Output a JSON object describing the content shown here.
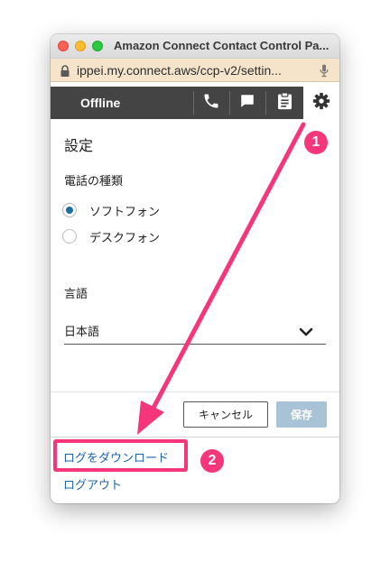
{
  "window": {
    "title": "Amazon Connect Contact Control Pa...",
    "url": "ippei.my.connect.aws/ccp-v2/settin..."
  },
  "header": {
    "status": "Offline",
    "icons": [
      "phone-icon",
      "chat-icon",
      "clipboard-icon",
      "gear-icon"
    ]
  },
  "settings": {
    "title": "設定",
    "phone_type_label": "電話の種類",
    "phone_options": [
      {
        "label": "ソフトフォン",
        "selected": true
      },
      {
        "label": "デスクフォン",
        "selected": false
      }
    ],
    "language_label": "言語",
    "language_value": "日本語"
  },
  "actions": {
    "cancel_label": "キャンセル",
    "save_label": "保存"
  },
  "links": {
    "download_logs": "ログをダウンロード",
    "logout": "ログアウト"
  },
  "annotations": {
    "callout_1": "1",
    "callout_2": "2",
    "color": "#f5367a"
  },
  "colors": {
    "header_bg": "#444444",
    "radio_selected": "#1d6ea1",
    "save_disabled": "#a9c3d6",
    "link": "#1f63a8"
  }
}
